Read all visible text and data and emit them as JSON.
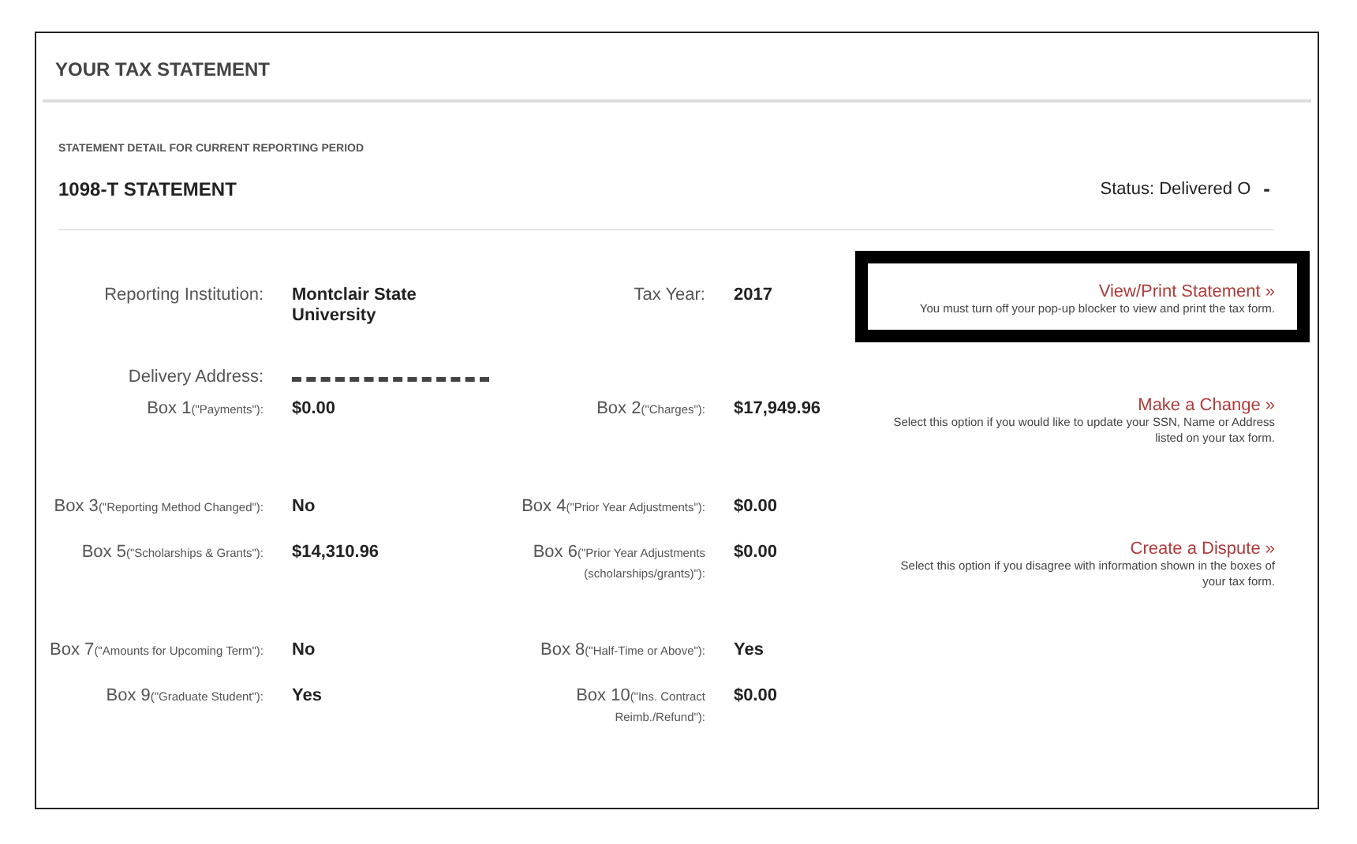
{
  "panel": {
    "title": "YOUR TAX STATEMENT"
  },
  "section": {
    "caption": "STATEMENT DETAIL FOR CURRENT REPORTING PERIOD",
    "heading": "1098-T STATEMENT",
    "status": "Status: Delivered O",
    "collapse": "-"
  },
  "rows": [
    {
      "left": {
        "label": "Reporting Institution:",
        "value": "Montclair State University"
      },
      "right": {
        "label": "Tax Year:",
        "value": "2017"
      },
      "action": {
        "link": "View/Print Statement »",
        "text": "You must turn off your pop-up blocker to view and print the tax form.",
        "highlighted": true
      }
    },
    {
      "left": {
        "label": "Delivery Address:",
        "redacted": true
      }
    },
    {
      "left": {
        "label": "Box 1",
        "note": "(\"Payments\"):",
        "value": "$0.00"
      },
      "right": {
        "label": "Box 2",
        "note": "(\"Charges\"):",
        "value": "$17,949.96"
      },
      "action": {
        "link": "Make a Change »",
        "text": "Select this option if you would like to update your SSN, Name or Address listed on your tax form.",
        "highlighted": false
      }
    },
    {
      "left": {
        "label": "Box 3",
        "note": "(\"Reporting Method Changed\"):",
        "value": "No"
      },
      "right": {
        "label": "Box 4",
        "note": "(\"Prior Year Adjustments\"):",
        "value": "$0.00"
      }
    },
    {
      "left": {
        "label": "Box 5",
        "note": "(\"Scholarships & Grants\"):",
        "value": "$14,310.96"
      },
      "right": {
        "label": "Box 6",
        "note": "(\"Prior Year Adjustments (scholarships/grants)\"):",
        "value": "$0.00"
      },
      "action": {
        "link": "Create a Dispute »",
        "text": "Select this option if you disagree with information shown in the boxes of your tax form.",
        "highlighted": false
      }
    },
    {
      "left": {
        "label": "Box 7",
        "note": "(\"Amounts for Upcoming Term\"):",
        "value": "No"
      },
      "right": {
        "label": "Box 8",
        "note": "(\"Half-Time or Above\"):",
        "value": "Yes"
      }
    },
    {
      "left": {
        "label": "Box 9",
        "note": "(\"Graduate Student\"):",
        "value": "Yes"
      },
      "right": {
        "label": "Box 10",
        "note": "(\"Ins. Contract Reimb./Refund\"):",
        "value": "$0.00"
      }
    }
  ]
}
